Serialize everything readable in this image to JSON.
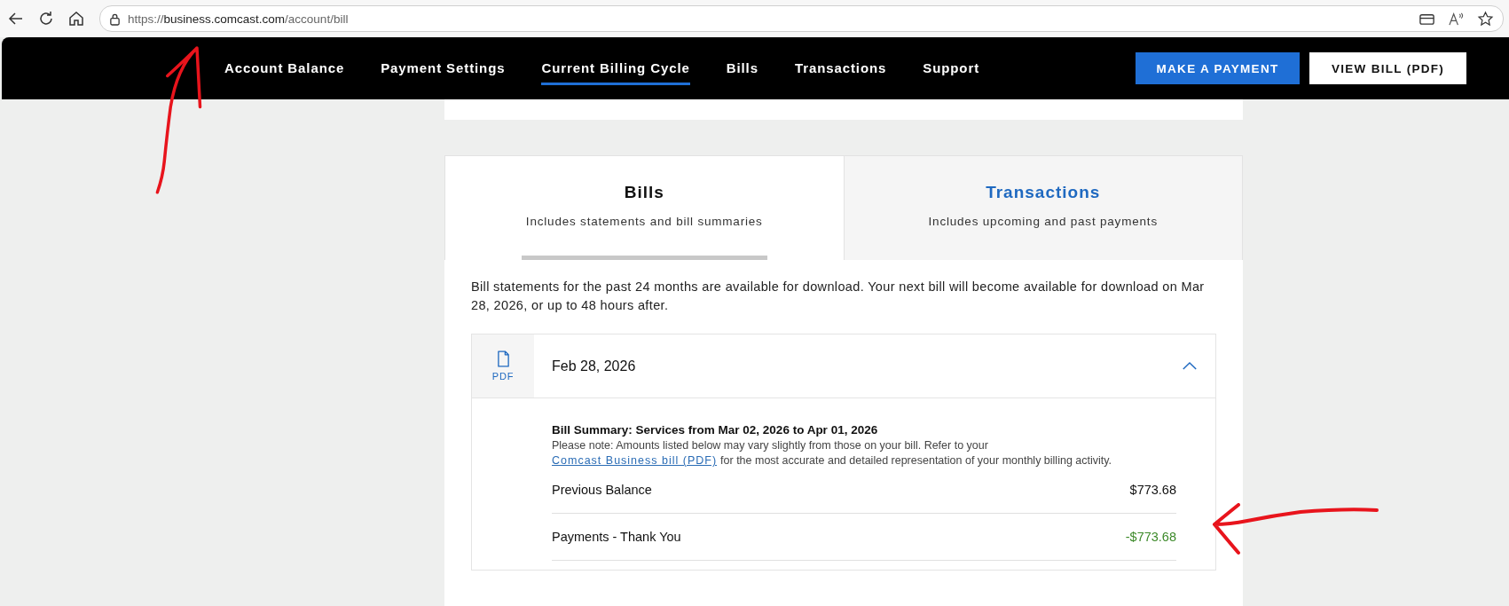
{
  "browser": {
    "url": {
      "scheme": "https://",
      "host": "business.comcast.com",
      "path": "/account/bill"
    }
  },
  "nav": {
    "items": [
      {
        "label": "Account Balance",
        "selected": false
      },
      {
        "label": "Payment Settings",
        "selected": false
      },
      {
        "label": "Current Billing Cycle",
        "selected": true
      },
      {
        "label": "Bills",
        "selected": false
      },
      {
        "label": "Transactions",
        "selected": false
      },
      {
        "label": "Support",
        "selected": false
      }
    ],
    "buttons": [
      {
        "label": "MAKE A PAYMENT",
        "kind": "primary"
      },
      {
        "label": "VIEW BILL (PDF)",
        "kind": "secondary"
      }
    ]
  },
  "tabs": [
    {
      "title": "Bills",
      "subtitle": "Includes statements and bill summaries",
      "selected": true
    },
    {
      "title": "Transactions",
      "subtitle": "Includes upcoming and past payments",
      "selected": false
    }
  ],
  "intro": "Bill statements for the past 24 months are available for download. Your next bill will become available for download on Mar 28, 2026, or up to 48 hours after.",
  "bill": {
    "file_label": "PDF",
    "date": "Feb 28, 2026",
    "expanded": true,
    "summary_title": "Bill Summary: Services from Mar 02, 2026 to Apr 01, 2026",
    "note": "Please note: Amounts listed below may vary slightly from those on your bill. Refer to your",
    "link": "Comcast Business bill (PDF)",
    "note_end": "for the most accurate and detailed representation of your monthly billing activity.",
    "lines": [
      {
        "label": "Previous Balance",
        "amount": "$773.68",
        "kind": "charge"
      },
      {
        "label": "Payments - Thank You",
        "amount": "-$773.68",
        "kind": "credit"
      }
    ]
  }
}
